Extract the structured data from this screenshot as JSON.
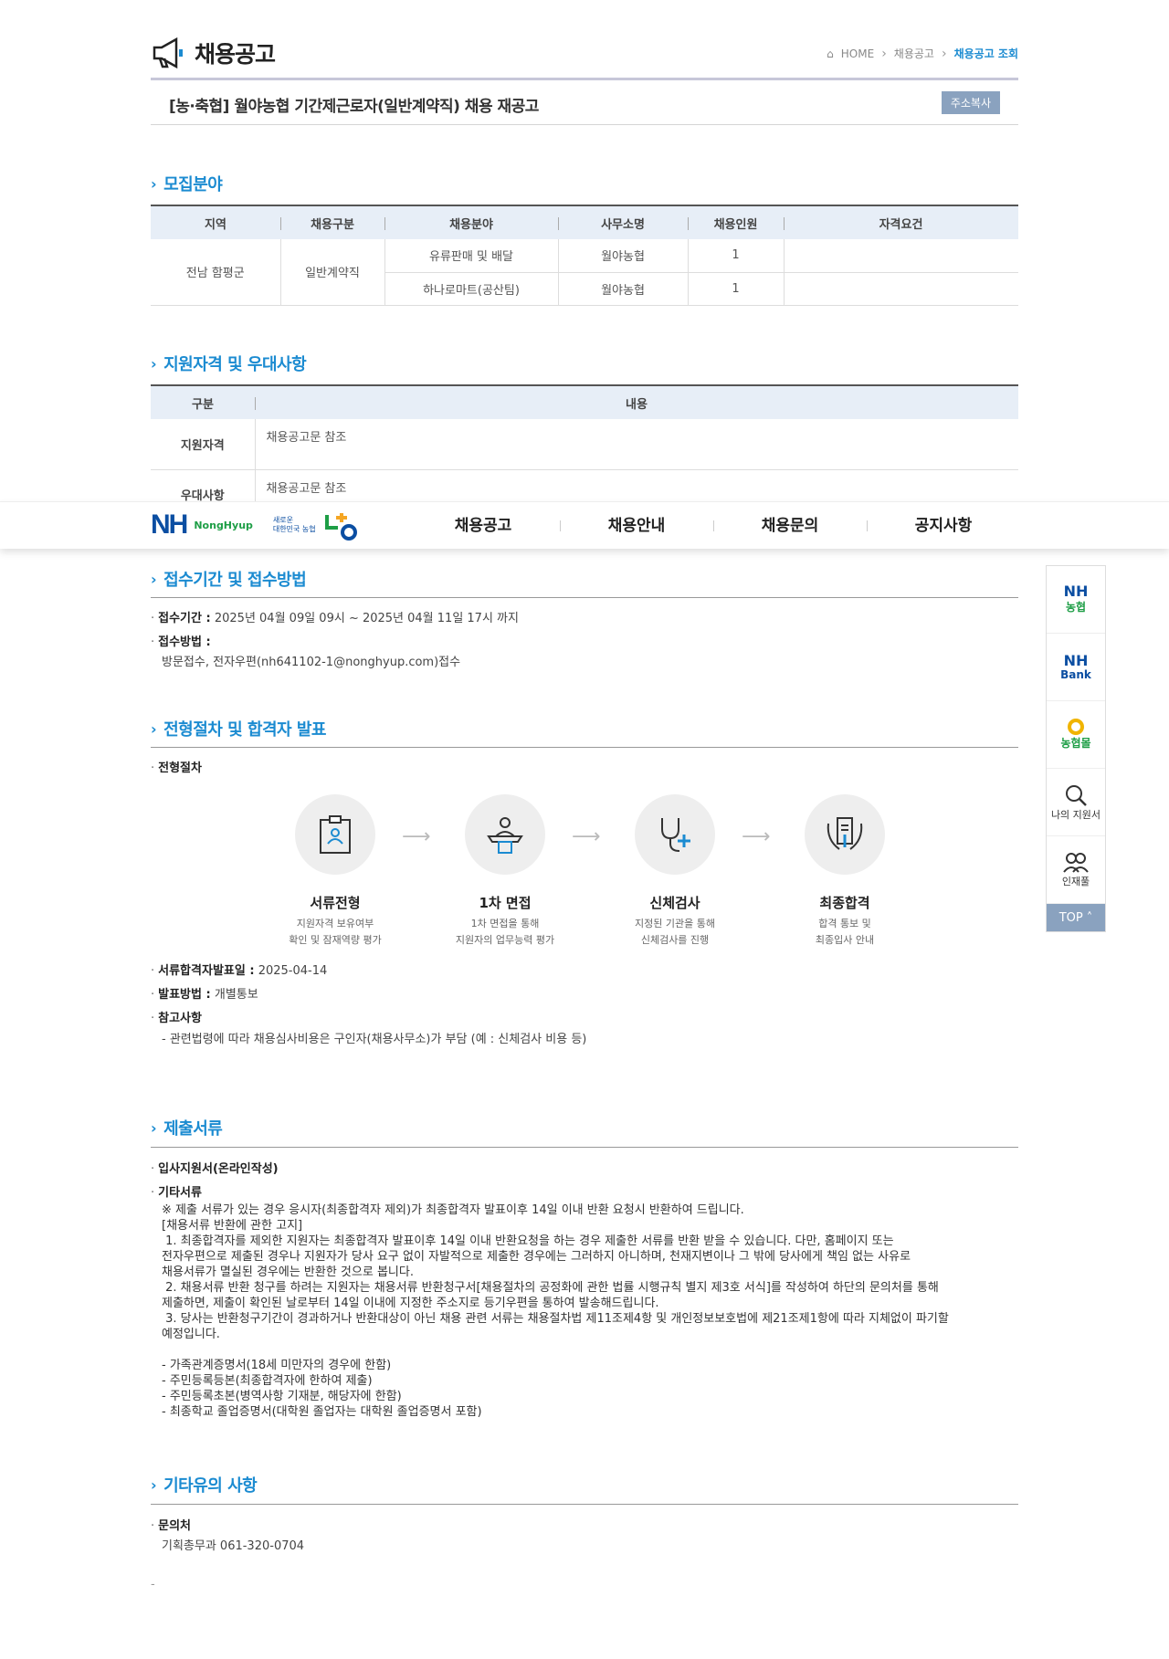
{
  "header": {
    "title": "채용공고",
    "crumbs": [
      "HOME",
      "채용공고",
      "채용공고 조회"
    ]
  },
  "subject": {
    "title": "[농·축협] 월야농협 기간제근로자(일반계약직) 채용 재공고",
    "copy_button": "주소복사"
  },
  "sections": {
    "recruit": "모집분야",
    "qualify": "지원자격 및 우대사항",
    "apply": "접수기간 및 접수방법",
    "process": "전형절차 및 합격자 발표",
    "docs": "제출서류",
    "etc": "기타유의 사항"
  },
  "recruit_table": {
    "headers": [
      "지역",
      "채용구분",
      "채용분야",
      "사무소명",
      "채용인원",
      "자격요건"
    ],
    "region": "전남 함평군",
    "type": "일반계약직",
    "rows": [
      {
        "field": "유류판매 및 배달",
        "office": "월야농협",
        "count": "1",
        "req": ""
      },
      {
        "field": "하나로마트(공산팀)",
        "office": "월야농협",
        "count": "1",
        "req": ""
      }
    ]
  },
  "qualify_table": {
    "headers": [
      "구분",
      "내용"
    ],
    "rows": [
      {
        "label": "지원자격",
        "content": "채용공고문 참조"
      },
      {
        "label": "우대사항",
        "content": "채용공고문 참조"
      }
    ]
  },
  "nav": {
    "logo_text": "NH",
    "logo_sub": "NongHyup",
    "logo_tag_1": "새로운",
    "logo_tag_2": "대한민국 농협",
    "menu": [
      "채용공고",
      "채용안내",
      "채용문의",
      "공지사항"
    ]
  },
  "apply": {
    "period_label": "접수기간 :",
    "period_value": "2025년 04월 09일 09시 ~ 2025년 04월 11일 17시 까지",
    "method_label": "접수방법 :",
    "method_value": "방문접수, 전자우편(nh641102-1@nonghyup.com)접수"
  },
  "process": {
    "label": "전형절차",
    "steps": [
      {
        "name": "서류전형",
        "desc1": "지원자격 보유여부",
        "desc2": "확인 및 잠재역량 평가"
      },
      {
        "name": "1차 면접",
        "desc1": "1차 면접을 통해",
        "desc2": "지원자의 업무능력 평가"
      },
      {
        "name": "신체검사",
        "desc1": "지정된 기관을 통해",
        "desc2": "신체검사를 진행"
      },
      {
        "name": "최종합격",
        "desc1": "합격 통보 및",
        "desc2": "최종입사 안내"
      }
    ],
    "announce_label": "서류합격자발표일 :",
    "announce_value": "2025-04-14",
    "notify_label": "발표방법 :",
    "notify_value": "개별통보",
    "note_label": "참고사항",
    "note_value": "- 관련법령에 따라 채용심사비용은 구인자(채용사무소)가 부담 (예 : 신체검사 비용 등)"
  },
  "docs": {
    "item1": "입사지원서(온라인작성)",
    "item2": "기타서류",
    "body": "※ 제출 서류가 있는 경우 응시자(최종합격자 제외)가 최종합격자 발표이후 14일 이내 반환 요청시 반환하여 드립니다.\n[채용서류 반환에 관한 고지]\n 1. 최종합격자를 제외한 지원자는 최종합격자 발표이후 14일 이내 반환요청을 하는 경우 제출한 서류를 반환 받을 수 있습니다. 다만, 홈페이지 또는\n전자우편으로 제출된 경우나 지원자가 당사 요구 없이 자발적으로 제출한 경우에는 그러하지 아니하며, 천재지변이나 그 밖에 당사에게 책임 없는 사유로\n채용서류가 멸실된 경우에는 반환한 것으로 봅니다.\n 2. 채용서류 반환 청구를 하려는 지원자는 채용서류 반환청구서[채용절차의 공정화에 관한 법률 시행규칙 별지 제3호 서식]를 작성하여 하단의 문의처를 통해\n제출하면, 제출이 확인된 날로부터 14일 이내에 지정한 주소지로 등기우편을 통하여 발송해드립니다.\n 3. 당사는 반환청구기간이 경과하거나 반환대상이 아닌 채용 관련 서류는 채용절차법 제11조제4항 및 개인정보보호법에 제21조제1항에 따라 지체없이 파기할\n예정입니다.\n\n- 가족관계증명서(18세 미만자의 경우에 한함)\n- 주민등록등본(최종합격자에 한하여 제출)\n- 주민등록초본(병역사항 기재분, 해당자에 한함)\n- 최종학교 졸업증명서(대학원 졸업자는 대학원 졸업증명서 포함)"
  },
  "etc": {
    "contact_label": "문의처",
    "contact_value": "기획총무과 061-320-0704",
    "trailing": "-"
  },
  "quick": {
    "q1_top": "NH",
    "q1_bottom": "농협",
    "q2_top": "NH",
    "q2_bottom": "Bank",
    "q3_bottom": "농협몰",
    "q4": "나의 지원서",
    "q5": "인재풀",
    "top": "TOP"
  }
}
